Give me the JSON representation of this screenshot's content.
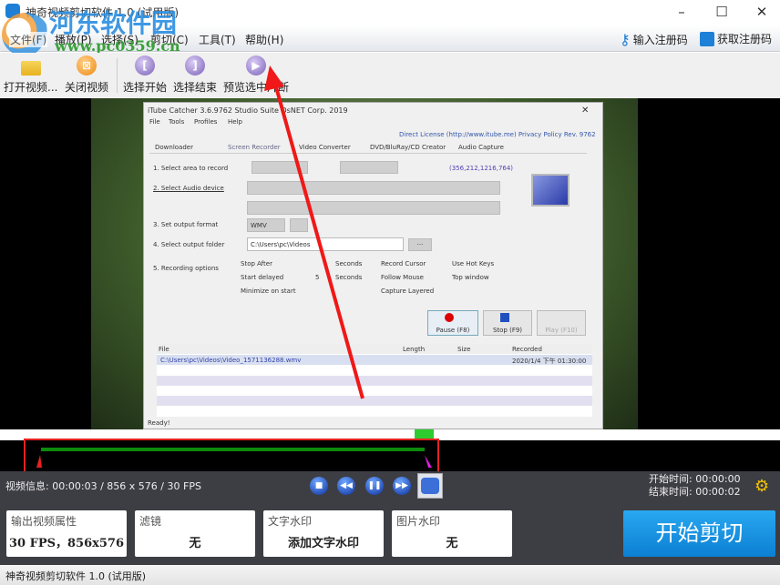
{
  "window": {
    "title": "神奇视频剪切软件 1.0 (试用版)",
    "minimize": "–",
    "maximize": "☐",
    "close": "✕"
  },
  "watermark": {
    "name": "河东软件园",
    "url": "www.pc0359.cn"
  },
  "menu": [
    "文件(F)",
    "播放(P)",
    "选择(S)",
    "剪切(C)",
    "工具(T)",
    "帮助(H)"
  ],
  "registration": {
    "enter": "输入注册码",
    "get": "获取注册码"
  },
  "toolbar": {
    "open": "打开视频...",
    "close": "关闭视频",
    "sel_start": "选择开始",
    "sel_end": "选择结束",
    "preview": "预览选中片断"
  },
  "video_frame": {
    "title": "iTube Catcher 3.6.9762   Studio Suite   DsNET Corp. 2019",
    "menu": [
      "File",
      "Tools",
      "Profiles",
      "Help"
    ],
    "license": "Direct License (http://www.itube.me)   Privacy Policy   Rev. 9762",
    "tabs": [
      "Downloader",
      "Screen Recorder",
      "Video Converter",
      "DVD/BluRay/CD Creator",
      "Audio Capture"
    ],
    "steps": [
      "1. Select area to record",
      "2. Select Audio device",
      "3. Set output format",
      "4. Select output folder",
      "5. Recording options"
    ],
    "coords": "(356,212,1216,764)",
    "format": "WMV",
    "folder": "C:\\Users\\pc\\Videos",
    "options": [
      "Stop After",
      "Start delayed",
      "Minimize on start",
      "Record Cursor",
      "Follow Mouse",
      "Capture Layered",
      "Use Hot Keys",
      "Top window"
    ],
    "seconds": "Seconds",
    "delay": "5",
    "buttons": [
      "Pause (F8)",
      "Stop (F9)",
      "Play (F10)"
    ],
    "columns": [
      "File",
      "Length",
      "Size",
      "Recorded"
    ],
    "row": [
      "C:\\Users\\pc\\Videos\\Video_1571136288.wmv",
      "",
      "",
      "2020/1/4 下午 01:30:00"
    ],
    "status": "Ready!"
  },
  "info": {
    "video": "视频信息:  00:00:03 / 856 x 576 / 30 FPS",
    "start": "开始时间:  00:00:00",
    "end": "结束时间:  00:00:02"
  },
  "controls": {
    "stop": "■",
    "rewind": "◀◀",
    "pause": "❚❚",
    "forward": "▶▶"
  },
  "cards": [
    {
      "label": "输出视频属性",
      "value": "30 FPS，856x576"
    },
    {
      "label": "滤镜",
      "value": "无"
    },
    {
      "label": "文字水印",
      "value": "添加文字水印"
    },
    {
      "label": "图片水印",
      "value": "无"
    }
  ],
  "cut_button": "开始剪切",
  "statusbar": "神奇视频剪切软件 1.0 (试用版)",
  "colors": {
    "accent": "#0c7fd3",
    "timeline_progress": "#0c8a0c",
    "annotation": "#e52222"
  }
}
